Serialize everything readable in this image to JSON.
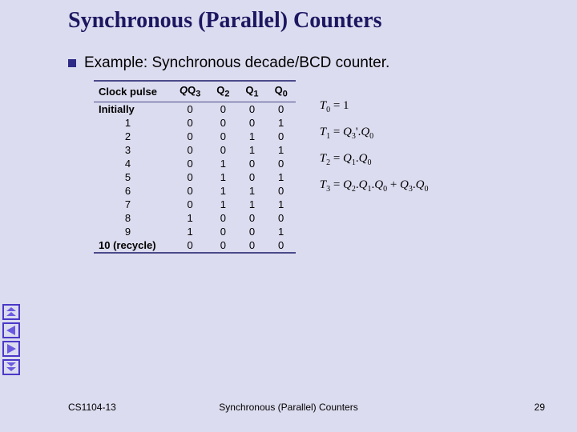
{
  "title": "Synchronous (Parallel) Counters",
  "bullet": "Example: Synchronous decade/BCD counter.",
  "table": {
    "headers": [
      "Clock pulse",
      "Q3",
      "Q2",
      "Q1",
      "Q0"
    ],
    "rows": [
      {
        "label": "Initially",
        "q3": "0",
        "q2": "0",
        "q1": "0",
        "q0": "0"
      },
      {
        "label": "1",
        "q3": "0",
        "q2": "0",
        "q1": "0",
        "q0": "1"
      },
      {
        "label": "2",
        "q3": "0",
        "q2": "0",
        "q1": "1",
        "q0": "0"
      },
      {
        "label": "3",
        "q3": "0",
        "q2": "0",
        "q1": "1",
        "q0": "1"
      },
      {
        "label": "4",
        "q3": "0",
        "q2": "1",
        "q1": "0",
        "q0": "0"
      },
      {
        "label": "5",
        "q3": "0",
        "q2": "1",
        "q1": "0",
        "q0": "1"
      },
      {
        "label": "6",
        "q3": "0",
        "q2": "1",
        "q1": "1",
        "q0": "0"
      },
      {
        "label": "7",
        "q3": "0",
        "q2": "1",
        "q1": "1",
        "q0": "1"
      },
      {
        "label": "8",
        "q3": "1",
        "q2": "0",
        "q1": "0",
        "q0": "0"
      },
      {
        "label": "9",
        "q3": "1",
        "q2": "0",
        "q1": "0",
        "q0": "1"
      },
      {
        "label": "10 (recycle)",
        "q3": "0",
        "q2": "0",
        "q1": "0",
        "q0": "0"
      }
    ]
  },
  "equations": {
    "t0": {
      "lhs_sub": "0",
      "rhs": "1"
    },
    "t1": {
      "lhs_sub": "1",
      "a_sub": "3",
      "b_sub": "0"
    },
    "t2": {
      "lhs_sub": "2",
      "a_sub": "1",
      "b_sub": "0"
    },
    "t3": {
      "lhs_sub": "3",
      "a_sub": "2",
      "b_sub": "1",
      "c_sub": "0",
      "d_sub": "3",
      "e_sub": "0",
      "plus": " + "
    }
  },
  "eq_sym": {
    "T": "T",
    "Q": "Q",
    "eq": " = ",
    "dot": ".",
    "prime": "'"
  },
  "footer": {
    "left": "CS1104-13",
    "center": "Synchronous (Parallel) Counters",
    "right": "29"
  },
  "nav": {
    "first": "first-slide",
    "prev": "prev-slide",
    "next": "next-slide",
    "last": "last-slide"
  }
}
